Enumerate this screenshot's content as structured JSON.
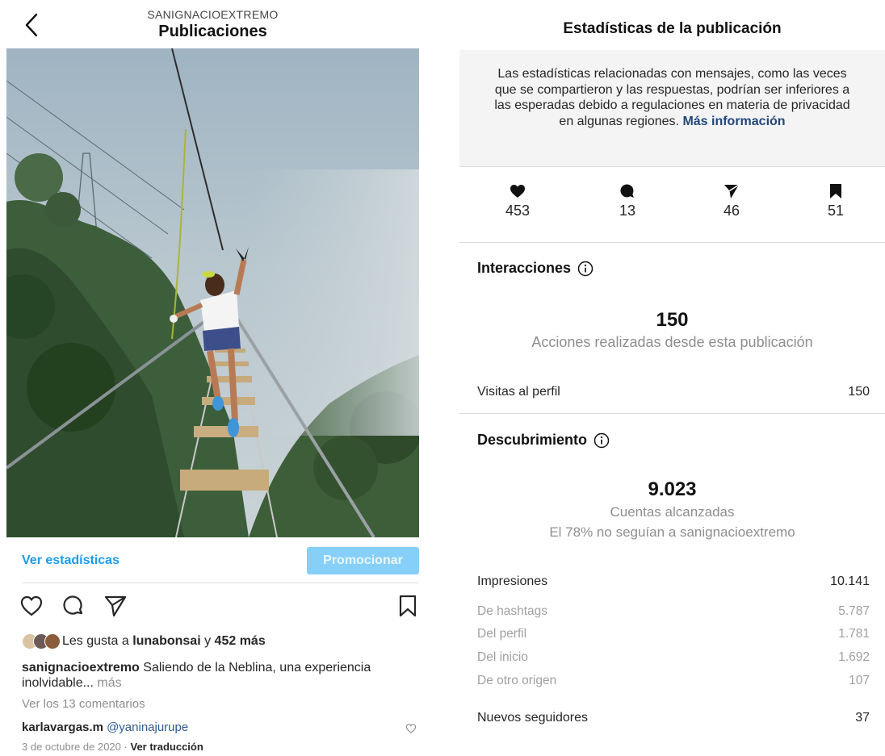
{
  "left": {
    "header": {
      "account": "SANIGNACIOEXTREMO",
      "title": "Publicaciones"
    },
    "actions": {
      "stats_link": "Ver estadísticas",
      "promote": "Promocionar"
    },
    "likes": {
      "prefix": "Les gusta a",
      "user": "lunabonsai",
      "connector": "y",
      "others": "452 más"
    },
    "caption": {
      "user": "sanignacioextremo",
      "text": "Saliendo de la Neblina, una experiencia inolvidable...",
      "more": "más"
    },
    "view_comments": "Ver los 13 comentarios",
    "comment": {
      "user": "karlavargas.m",
      "mention": "@yaninajurupe"
    },
    "date": "3 de octubre de 2020",
    "date_sep": "·",
    "translate": "Ver traducción"
  },
  "right": {
    "title": "Estadísticas de la publicación",
    "notice": {
      "text": "Las estadísticas relacionadas con mensajes, como las veces que se compartieron y las respuestas, podrían ser inferiores a las esperadas debido a regulaciones en materia de privacidad en algunas regiones.",
      "link": "Más información"
    },
    "metrics": [
      {
        "icon": "heart-icon",
        "value": "453"
      },
      {
        "icon": "comment-icon",
        "value": "13"
      },
      {
        "icon": "share-icon",
        "value": "46"
      },
      {
        "icon": "bookmark-icon",
        "value": "51"
      }
    ],
    "interactions": {
      "title": "Interacciones",
      "total": "150",
      "subtitle": "Acciones realizadas desde esta publicación",
      "rows": [
        {
          "label": "Visitas al perfil",
          "value": "150"
        }
      ]
    },
    "discovery": {
      "title": "Descubrimiento",
      "total": "9.023",
      "subtitle": "Cuentas alcanzadas",
      "subtitle2": "El 78% no seguían a sanignacioextremo",
      "impressions": {
        "label": "Impresiones",
        "value": "10.141"
      },
      "sources": [
        {
          "label": "De hashtags",
          "value": "5.787"
        },
        {
          "label": "Del perfil",
          "value": "1.781"
        },
        {
          "label": "Del inicio",
          "value": "1.692"
        },
        {
          "label": "De otro origen",
          "value": "107"
        }
      ],
      "new_followers": {
        "label": "Nuevos seguidores",
        "value": "37"
      }
    }
  },
  "colors": {
    "link_blue": "#1a9cf0",
    "promote_bg": "#86cff8",
    "dark_link": "#22477a"
  }
}
